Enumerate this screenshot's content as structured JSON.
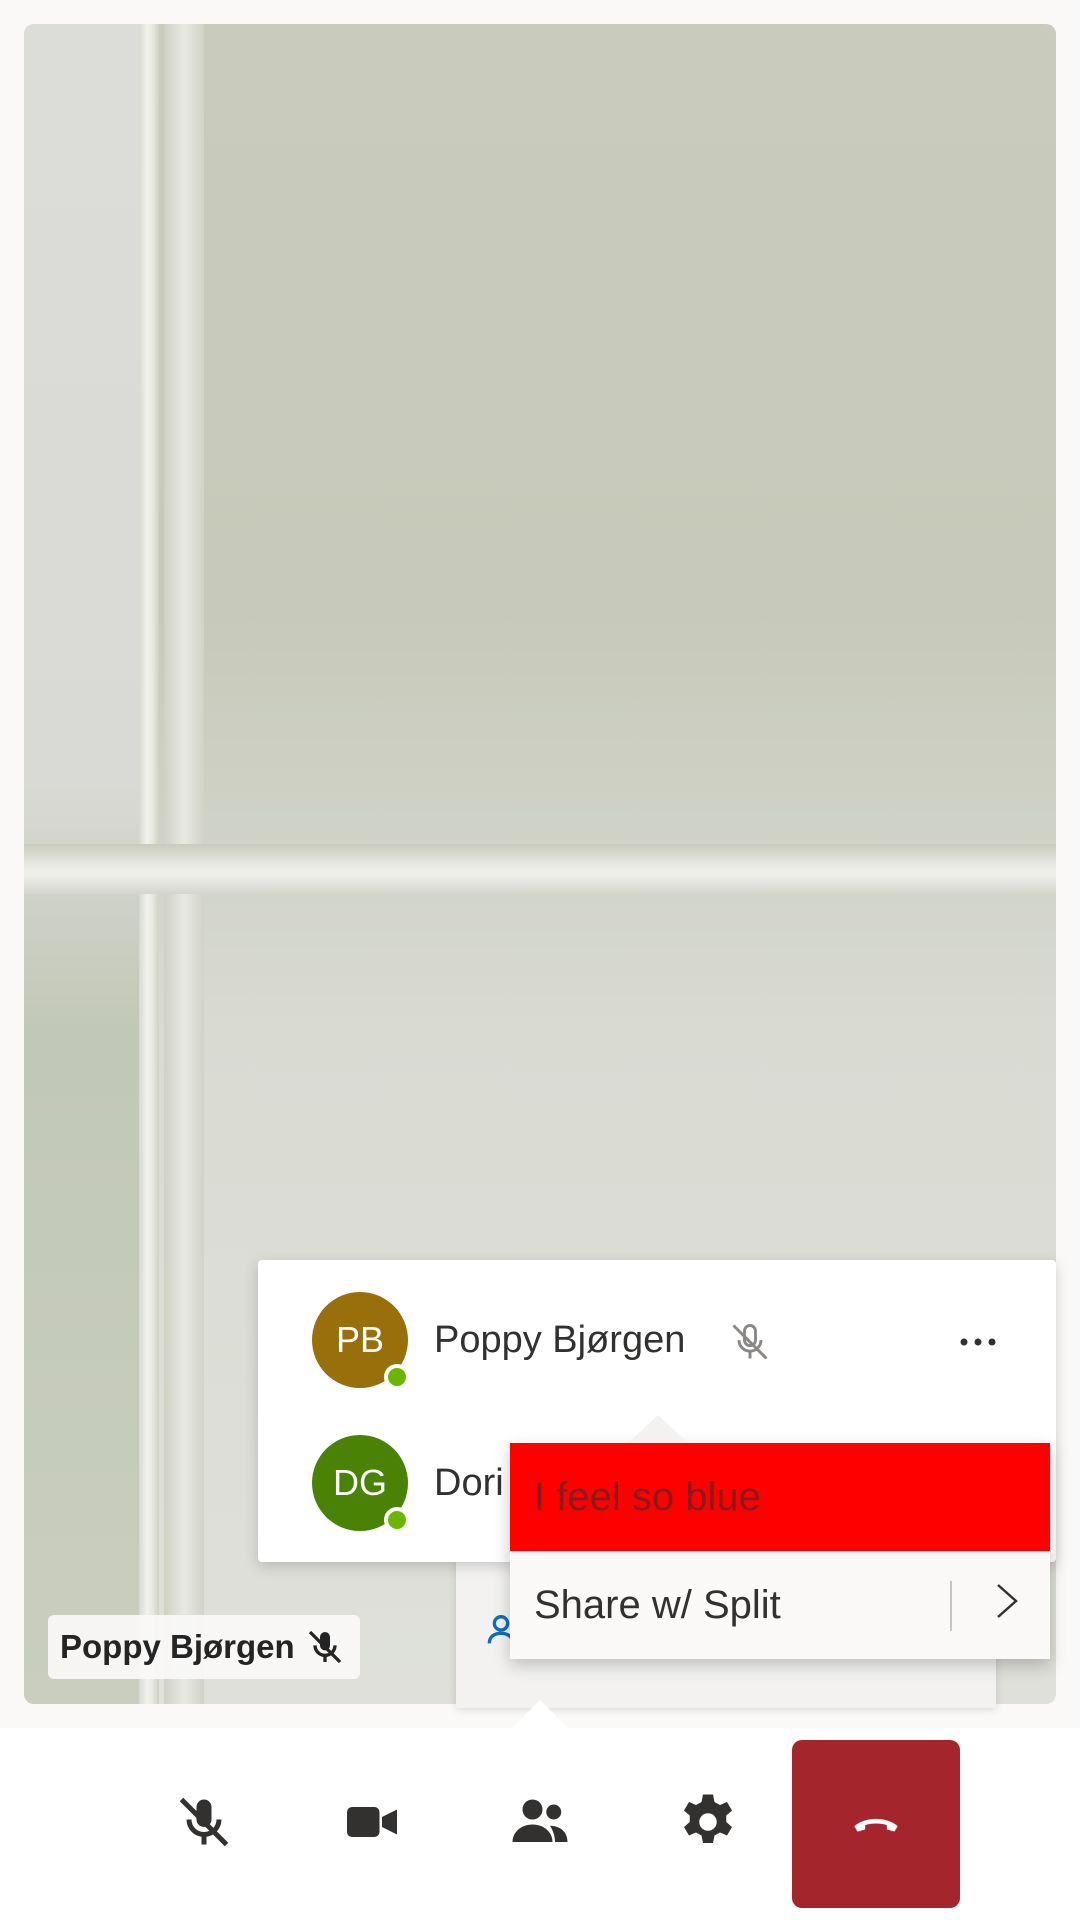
{
  "video": {
    "name_label": "Poppy Bjørgen",
    "mic_icon": "mic-off-icon"
  },
  "participants": [
    {
      "initials": "PB",
      "name": "Poppy Bjørgen",
      "avatar_color": "#986f0b",
      "presence": "available",
      "muted": true
    },
    {
      "initials": "DG",
      "name": "Dori",
      "avatar_color": "#498205",
      "presence": "available"
    }
  ],
  "menu": {
    "items": [
      {
        "label": "I feel so blue",
        "bg": "#ff0000"
      },
      {
        "label": "Share w/ Split",
        "icon": "chevron-right-icon"
      }
    ]
  },
  "controls": {
    "mic": "mic-off-icon",
    "camera": "video-camera-icon",
    "people": "people-icon",
    "settings": "gear-icon",
    "hangup": "hang-up-icon",
    "hangup_color": "#a4262c"
  }
}
